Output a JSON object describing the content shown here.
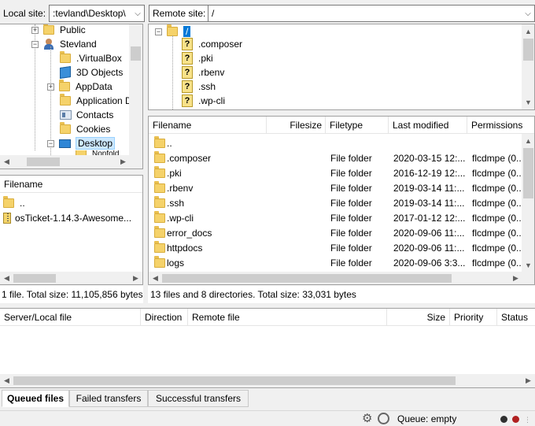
{
  "local": {
    "site_label": "Local site:",
    "path_value": ":tevland\\Desktop\\",
    "tree": [
      {
        "label": "Public",
        "icon": "folder-icon"
      },
      {
        "label": "Stevland",
        "icon": "user-folder-icon"
      },
      {
        "label": ".VirtualBox",
        "icon": "folder-icon"
      },
      {
        "label": "3D Objects",
        "icon": "3d-objects-icon"
      },
      {
        "label": "AppData",
        "icon": "folder-icon"
      },
      {
        "label": "Application D",
        "icon": "folder-icon"
      },
      {
        "label": "Contacts",
        "icon": "contacts-icon"
      },
      {
        "label": "Cookies",
        "icon": "folder-icon"
      },
      {
        "label": "Desktop",
        "icon": "desktop-icon"
      },
      {
        "label": "Nonfold",
        "icon": "folder-icon"
      }
    ],
    "list_header": "Filename",
    "files": [
      {
        "name": "..",
        "icon": "folder-icon"
      },
      {
        "name": "osTicket-1.14.3-Awesome...",
        "icon": "zip-icon"
      }
    ],
    "status": "1 file. Total size: 11,105,856 bytes"
  },
  "remote": {
    "site_label": "Remote site:",
    "path_value": "/",
    "tree": [
      {
        "label": "/",
        "icon": "folder-icon"
      },
      {
        "label": ".composer",
        "icon": "question-folder-icon"
      },
      {
        "label": ".pki",
        "icon": "question-folder-icon"
      },
      {
        "label": ".rbenv",
        "icon": "question-folder-icon"
      },
      {
        "label": ".ssh",
        "icon": "question-folder-icon"
      },
      {
        "label": ".wp-cli",
        "icon": "question-folder-icon"
      }
    ],
    "columns": [
      "Filename",
      "Filesize",
      "Filetype",
      "Last modified",
      "Permissions"
    ],
    "files": [
      {
        "name": "..",
        "size": "",
        "type": "",
        "modified": "",
        "perms": ""
      },
      {
        "name": ".composer",
        "size": "",
        "type": "File folder",
        "modified": "2020-03-15 12:...",
        "perms": "flcdmpe (0..."
      },
      {
        "name": ".pki",
        "size": "",
        "type": "File folder",
        "modified": "2016-12-19 12:...",
        "perms": "flcdmpe (0..."
      },
      {
        "name": ".rbenv",
        "size": "",
        "type": "File folder",
        "modified": "2019-03-14 11:...",
        "perms": "flcdmpe (0..."
      },
      {
        "name": ".ssh",
        "size": "",
        "type": "File folder",
        "modified": "2019-03-14 11:...",
        "perms": "flcdmpe (0..."
      },
      {
        "name": ".wp-cli",
        "size": "",
        "type": "File folder",
        "modified": "2017-01-12 12:...",
        "perms": "flcdmpe (0..."
      },
      {
        "name": "error_docs",
        "size": "",
        "type": "File folder",
        "modified": "2020-09-06 11:...",
        "perms": "flcdmpe (0..."
      },
      {
        "name": "httpdocs",
        "size": "",
        "type": "File folder",
        "modified": "2020-09-06 11:...",
        "perms": "flcdmpe (0..."
      },
      {
        "name": "logs",
        "size": "",
        "type": "File folder",
        "modified": "2020-09-06 3:3...",
        "perms": "flcdmpe (0..."
      }
    ],
    "status": "13 files and 8 directories. Total size: 33,031 bytes"
  },
  "queue": {
    "columns": [
      "Server/Local file",
      "Direction",
      "Remote file",
      "Size",
      "Priority",
      "Status"
    ],
    "tabs": [
      "Queued files",
      "Failed transfers",
      "Successful transfers"
    ],
    "active_tab": "Queued files",
    "queue_status": "Queue: empty"
  },
  "colors": {
    "selection": "#0078d7",
    "folder": "#f5d26a",
    "led_off": "#303030",
    "led_red": "#b02020"
  }
}
